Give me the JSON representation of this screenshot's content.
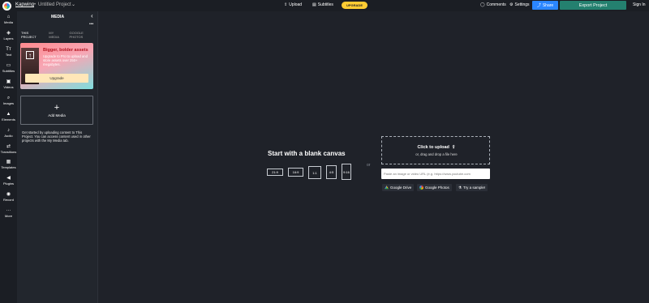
{
  "topbar": {
    "brand": "Kapwing",
    "separator": "•",
    "project_title": "Untitled Project",
    "upload_label": "Upload",
    "subtitles_label": "Subtitles",
    "upgrade_label": "UPGRADE",
    "comments_label": "Comments",
    "settings_label": "Settings",
    "share_label": "Share",
    "export_label": "Export Project",
    "signin_label": "Sign In"
  },
  "sidebar": {
    "items": [
      {
        "label": "Media",
        "icon": "home-icon"
      },
      {
        "label": "Layers",
        "icon": "layers-icon"
      },
      {
        "label": "Text",
        "icon": "text-icon"
      },
      {
        "label": "Subtitles",
        "icon": "subtitles-icon"
      },
      {
        "label": "Videos",
        "icon": "video-icon"
      },
      {
        "label": "Images",
        "icon": "search-icon"
      },
      {
        "label": "Elements",
        "icon": "elements-icon"
      },
      {
        "label": "Audio",
        "icon": "music-icon"
      },
      {
        "label": "Transitions",
        "icon": "transitions-icon"
      },
      {
        "label": "Templates",
        "icon": "templates-icon"
      },
      {
        "label": "Plugins",
        "icon": "plugins-icon"
      },
      {
        "label": "Record",
        "icon": "record-icon"
      },
      {
        "label": "More",
        "icon": "more-icon"
      }
    ]
  },
  "panel": {
    "title": "MEDIA",
    "tabs": [
      "THIS PROJECT",
      "MY MEDIA",
      "GOOGLE PHOTOS"
    ],
    "promo": {
      "title": "Bigger, bolder assets",
      "text": "Upgrade to Pro to upload and store assets over 250+ megabytes.",
      "button": "Upgrade"
    },
    "add_media_label": "Add Media",
    "help_text": "Get started by uploading content to This Project. You can access content used in other projects with the My Media tab."
  },
  "canvas": {
    "title": "Start with a blank canvas",
    "ratios": [
      "21:9",
      "16:9",
      "1:1",
      "4:5",
      "9:16"
    ],
    "or_label": "or",
    "upload_title": "Click to upload",
    "upload_sub": "or, drag and drop a file here",
    "url_placeholder": "Paste an image or video URL (e.g. https://www.youtube.com",
    "sources": [
      "Google Drive",
      "Google Photos",
      "Try a sample!"
    ]
  },
  "colors": {
    "background": "#1f2229",
    "panel": "#22262d",
    "accent_blue": "#2b86ff",
    "export_green": "#24806f",
    "upgrade_yellow": "#ffcc33"
  }
}
